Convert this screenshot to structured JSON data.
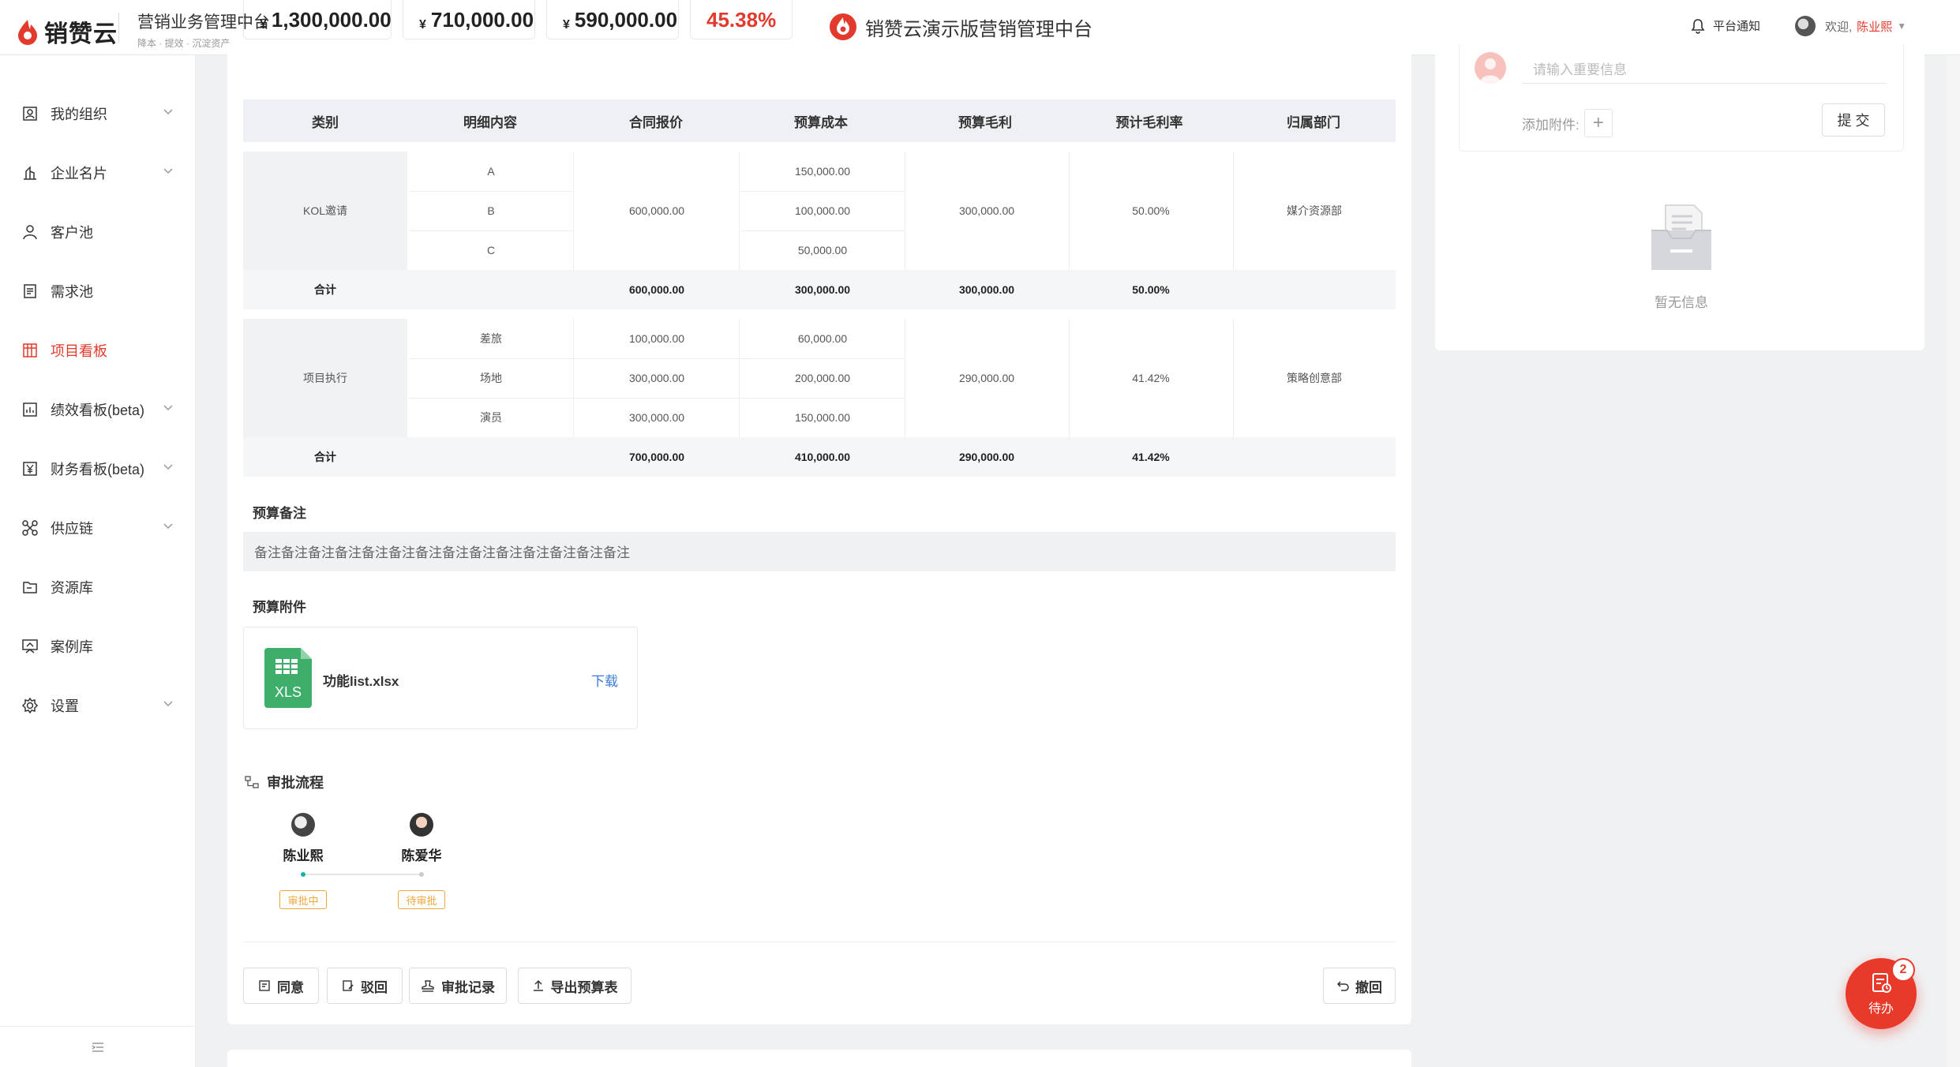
{
  "header": {
    "brand": "销赞云",
    "product": "营销业务管理中台",
    "product_sub": "降本 · 提效 · 沉淀资产",
    "center_title": "销赞云演示版营销管理中台",
    "notify": "平台通知",
    "welcome": "欢迎,",
    "username": "陈业熙"
  },
  "sidebar": {
    "items": [
      {
        "label": "我的组织"
      },
      {
        "label": "企业名片"
      },
      {
        "label": "客户池"
      },
      {
        "label": "需求池"
      },
      {
        "label": "项目看板"
      },
      {
        "label": "绩效看板(beta)"
      },
      {
        "label": "财务看板(beta)"
      },
      {
        "label": "供应链"
      },
      {
        "label": "资源库"
      },
      {
        "label": "案例库"
      },
      {
        "label": "设置"
      }
    ],
    "active_index": 4
  },
  "stats": {
    "currency": "¥",
    "total_quote": "1,300,000.00",
    "total_cost": "710,000.00",
    "total_profit": "590,000.00",
    "rate": "45.38%"
  },
  "table": {
    "headers": [
      "类别",
      "明细内容",
      "合同报价",
      "预算成本",
      "预算毛利",
      "预计毛利率",
      "归属部门"
    ],
    "groups": [
      {
        "category": "KOL邀请",
        "details": [
          "A",
          "B",
          "C"
        ],
        "quote_cells": [
          "",
          "600,000.00",
          ""
        ],
        "costs": [
          "150,000.00",
          "100,000.00",
          "50,000.00"
        ],
        "profit": "300,000.00",
        "rate": "50.00%",
        "dept": "媒介资源部",
        "sum": {
          "label": "合计",
          "quote": "600,000.00",
          "cost": "300,000.00",
          "profit": "300,000.00",
          "rate": "50.00%"
        }
      },
      {
        "category": "项目执行",
        "details": [
          "差旅",
          "场地",
          "演员"
        ],
        "quote_cells": [
          "100,000.00",
          "300,000.00",
          "300,000.00"
        ],
        "costs": [
          "60,000.00",
          "200,000.00",
          "150,000.00"
        ],
        "profit": "290,000.00",
        "rate": "41.42%",
        "dept": "策略创意部",
        "sum": {
          "label": "合计",
          "quote": "700,000.00",
          "cost": "410,000.00",
          "profit": "290,000.00",
          "rate": "41.42%"
        }
      }
    ]
  },
  "remark": {
    "title": "预算备注",
    "text": "备注备注备注备注备注备注备注备注备注备注备注备注备注备注"
  },
  "attachment": {
    "title": "预算附件",
    "file_type": "XLS",
    "file_name": "功能list.xlsx",
    "download": "下载"
  },
  "approval": {
    "title": "审批流程",
    "nodes": [
      {
        "name": "陈业熙",
        "status": "审批中"
      },
      {
        "name": "陈爱华",
        "status": "待审批"
      }
    ]
  },
  "actions": {
    "approve": "同意",
    "reject": "驳回",
    "records": "审批记录",
    "export": "导出预算表",
    "withdraw": "撤回"
  },
  "comment": {
    "placeholder": "请输入重要信息",
    "attach_label": "添加附件:",
    "submit": "提 交",
    "empty": "暂无信息"
  },
  "todo": {
    "label": "待办",
    "count": "2"
  },
  "colors": {
    "brand": "#e23b2e",
    "link": "#3a7bd5",
    "pending": "#f0a73a",
    "xls": "#3fae6a"
  }
}
